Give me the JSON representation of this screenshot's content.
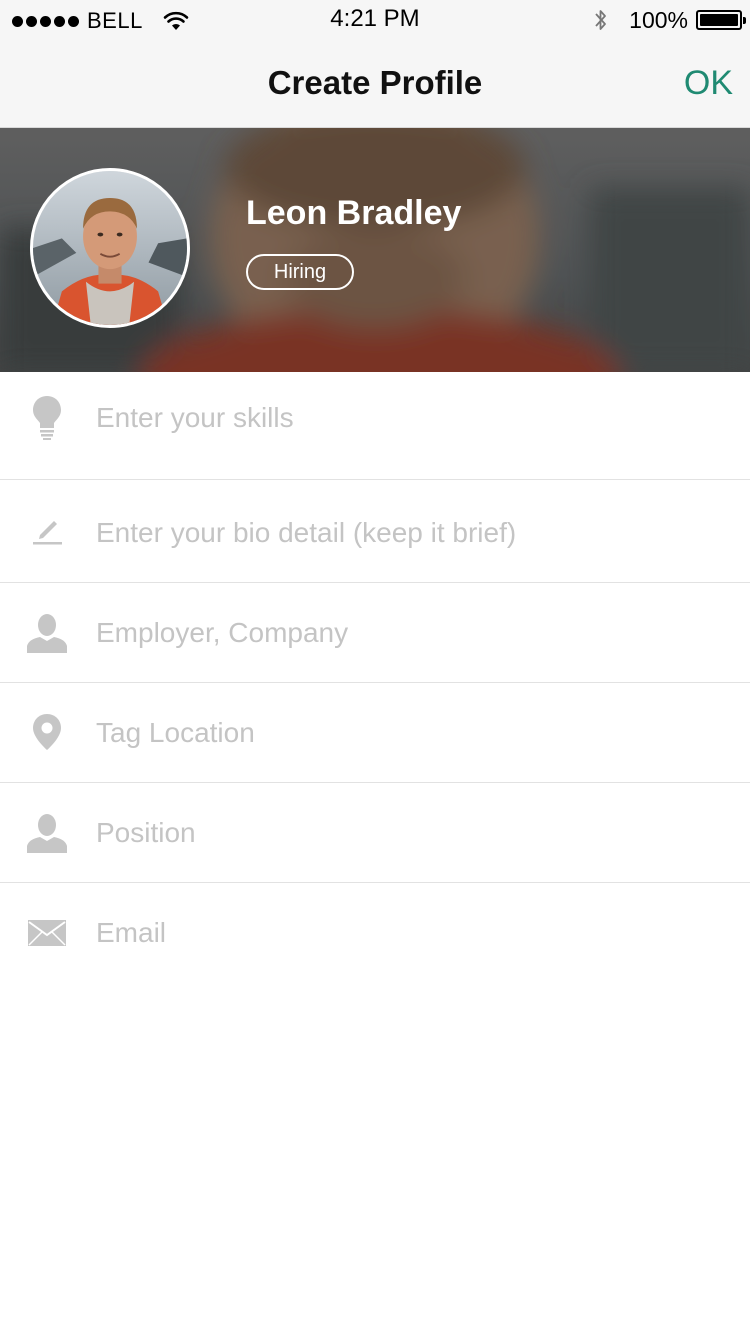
{
  "status_bar": {
    "carrier": "BELL",
    "time": "4:21 PM",
    "battery_percent": "100%",
    "battery_level": 1.0,
    "icons": [
      "signal-dots",
      "wifi-icon",
      "bluetooth-icon",
      "battery-icon"
    ]
  },
  "nav": {
    "title": "Create Profile",
    "ok_label": "OK",
    "accent_color": "#1f8a72"
  },
  "profile": {
    "name": "Leon Bradley",
    "status_badge": "Hiring"
  },
  "form": {
    "fields": [
      {
        "icon": "lightbulb-icon",
        "placeholder": "Enter your skills",
        "value": ""
      },
      {
        "icon": "pencil-icon",
        "placeholder": "Enter your bio detail (keep it brief)",
        "value": ""
      },
      {
        "icon": "person-icon",
        "placeholder": "Employer, Company",
        "value": ""
      },
      {
        "icon": "location-pin-icon",
        "placeholder": "Tag Location",
        "value": ""
      },
      {
        "icon": "person-icon",
        "placeholder": "Position",
        "value": ""
      },
      {
        "icon": "envelope-icon",
        "placeholder": "Email",
        "value": ""
      }
    ]
  }
}
